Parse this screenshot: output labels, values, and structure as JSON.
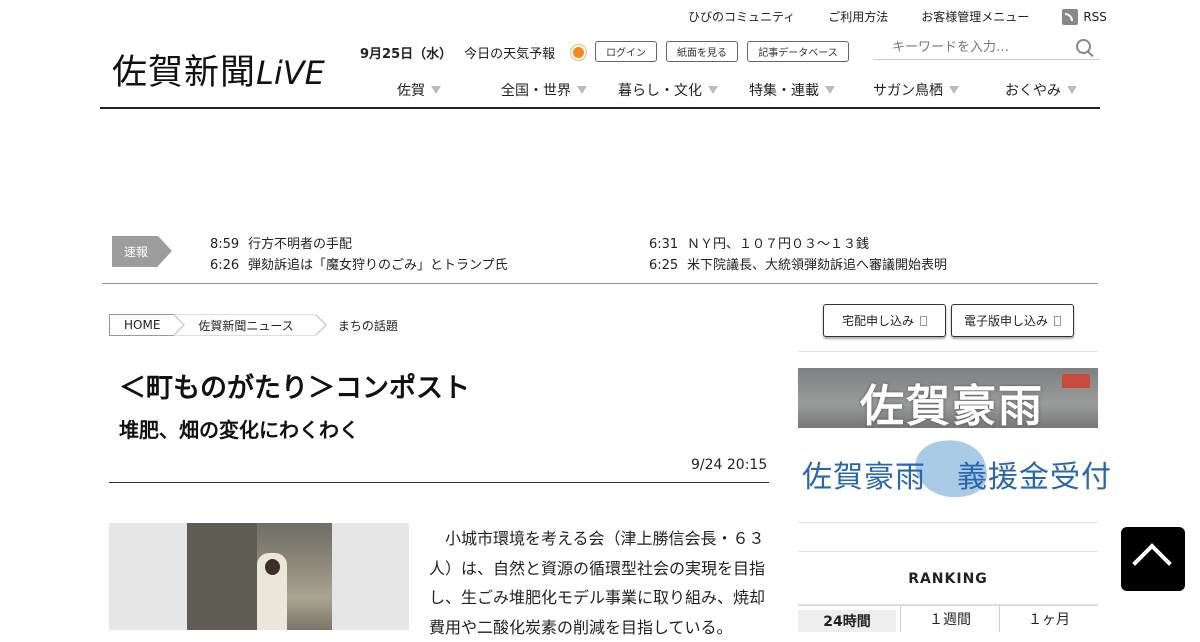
{
  "top_links": [
    "ひびのコミュニティ",
    "ご利用方法",
    "お客様管理メニュー"
  ],
  "rss_label": "RSS",
  "logo": {
    "main": "佐賀新聞",
    "live": "LiVE"
  },
  "date": "9月25日（水）",
  "weather_label": "今日の天気予報",
  "header_buttons": [
    "ログイン",
    "紙面を見る",
    "記事データベース"
  ],
  "search_placeholder": "キーワードを入力…",
  "nav": [
    "佐賀",
    "全国・世界",
    "暮らし・文化",
    "特集・連載",
    "サガン鳥栖",
    "おくやみ"
  ],
  "breaking": {
    "label": "速報",
    "items": [
      {
        "time": "8:59",
        "text": "行方不明者の手配"
      },
      {
        "time": "6:26",
        "text": "弾劾訴追は「魔女狩りのごみ」とトランプ氏"
      },
      {
        "time": "6:31",
        "text": "ＮＹ円、１０７円０３～１３銭"
      },
      {
        "time": "6:25",
        "text": "米下院議長、大統領弾劾訴追へ審議開始表明"
      }
    ]
  },
  "breadcrumb": [
    "HOME",
    "佐賀新聞ニュース",
    "まちの話題"
  ],
  "article": {
    "title": "＜町ものがたり＞コンポスト",
    "subtitle": "堆肥、畑の変化にわくわく",
    "time": "9/24 20:15",
    "body": "小城市環境を考える会（津上勝信会長・６３人）は、自然と資源の循環型社会の実現を目指し、生ごみ堆肥化モデル事業に取り組み、焼却費用や二酸化炭素の削減を目指している。"
  },
  "side_buttons": [
    "宅配申し込み",
    "電子版申し込み"
  ],
  "banners": {
    "top": "佐賀豪雨",
    "bottom": "佐賀豪雨　義援金受付"
  },
  "ranking": {
    "title": "RANKING",
    "tabs": [
      "24時間",
      "１週間",
      "１ヶ月"
    ]
  }
}
